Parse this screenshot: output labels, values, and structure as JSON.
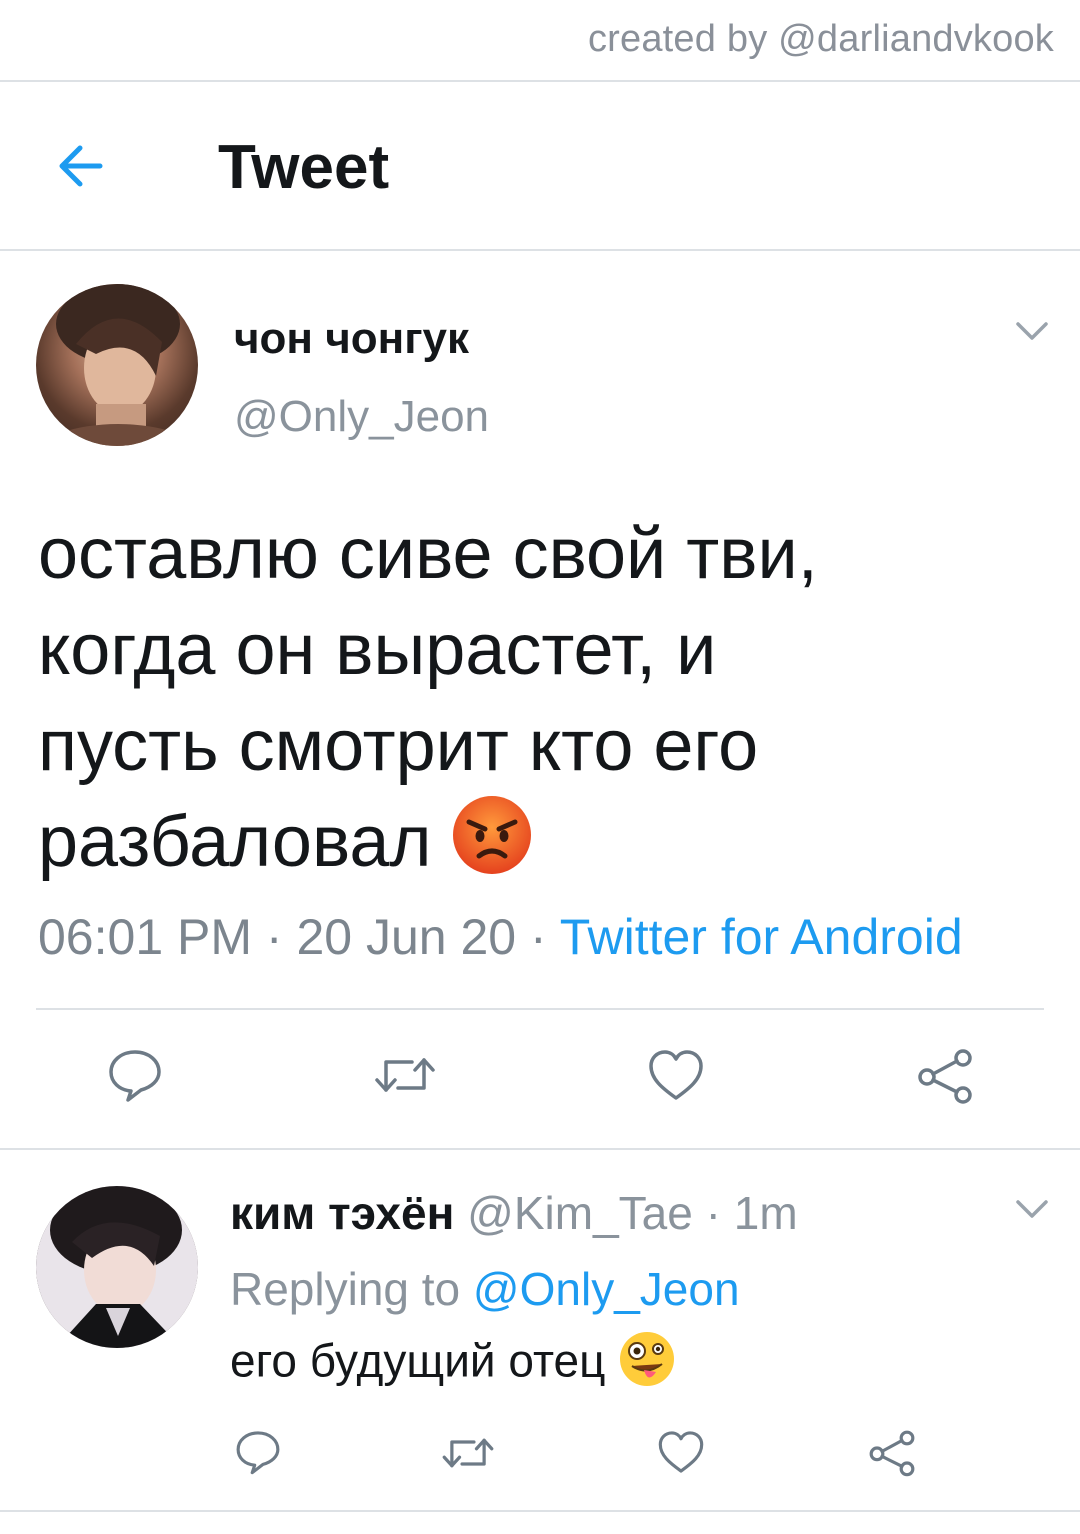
{
  "credit": "created by @darliandvkook",
  "header": {
    "title": "Tweet"
  },
  "tweet": {
    "author_name": "чон чонгук",
    "author_handle": "@Only_Jeon",
    "text_lines": [
      "оставлю сиве свой тви,",
      "когда он вырастет, и",
      "пусть смотрит кто его",
      "разбаловал"
    ],
    "text_emoji": "angry-face",
    "time": "06:01 PM",
    "date": "20 Jun 20",
    "separator": "·",
    "source": "Twitter for Android",
    "actions": [
      "reply",
      "retweet",
      "like",
      "share"
    ]
  },
  "reply": {
    "author_name": "ким тэхён",
    "author_handle": "@Kim_Tae",
    "separator": "·",
    "time": "1m",
    "replying_to_label": "Replying to",
    "replying_to_handle": "@Only_Jeon",
    "text": "его будущий отец",
    "text_emoji": "zany-face",
    "actions": [
      "reply",
      "retweet",
      "like",
      "share"
    ]
  },
  "colors": {
    "accent": "#1d9bf0",
    "secondary_text": "#8a939c",
    "divider": "#dde1e5",
    "icon": "#6d7a86"
  }
}
